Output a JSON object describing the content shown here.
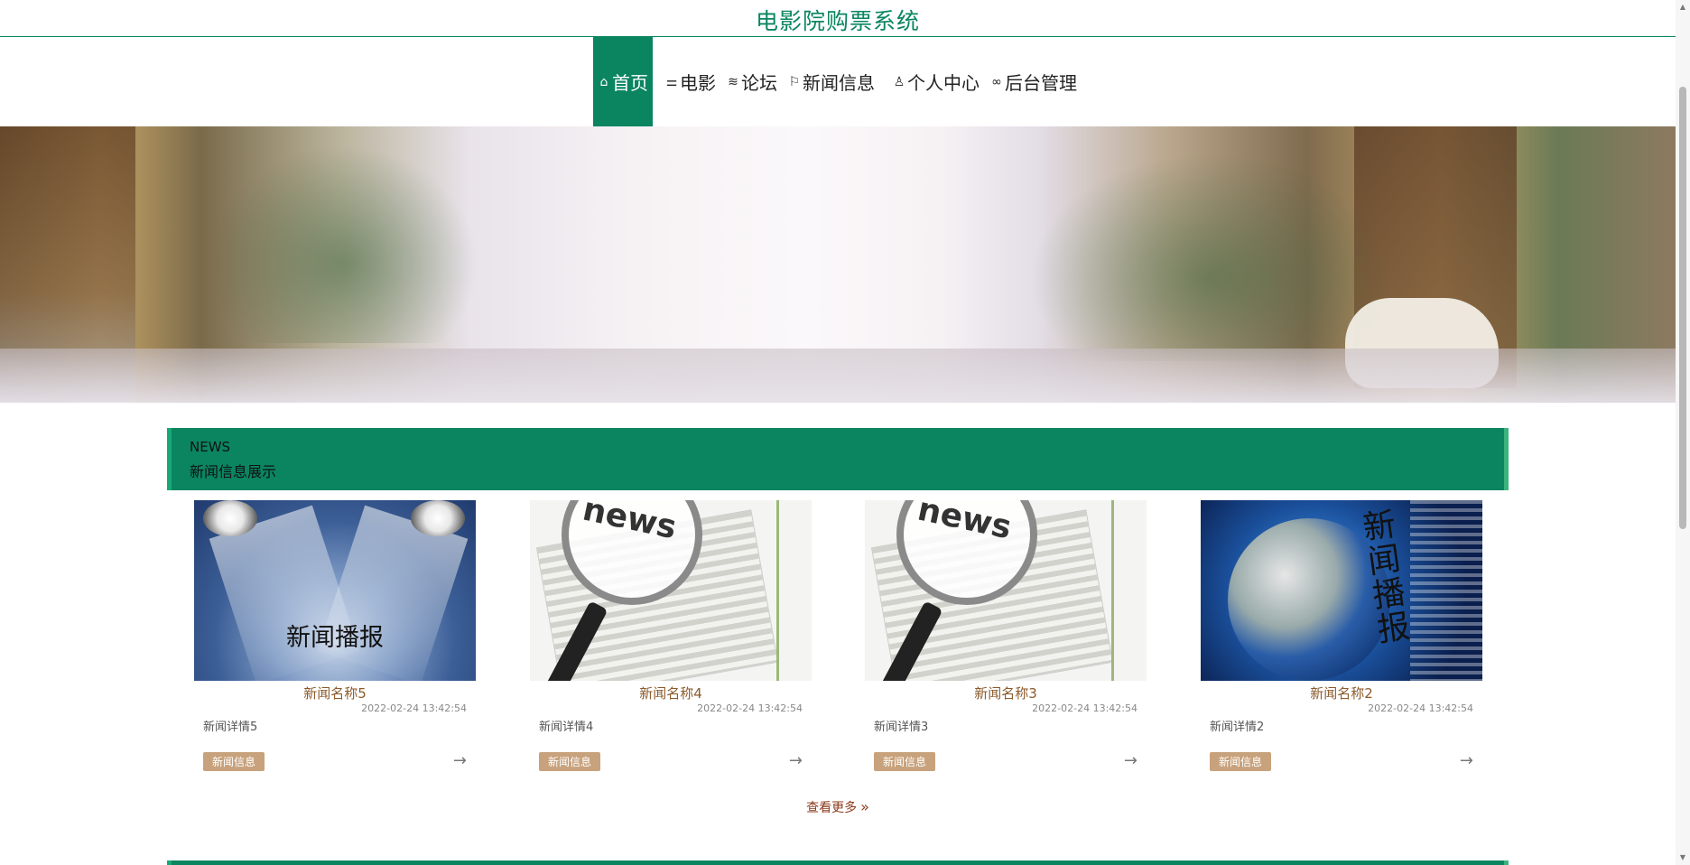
{
  "site": {
    "title": "电影院购票系统"
  },
  "nav": {
    "items": [
      {
        "label": "首页",
        "icon": "home-icon",
        "active": true
      },
      {
        "label": "电影",
        "icon": "sliders-icon",
        "active": false
      },
      {
        "label": "论坛",
        "icon": "layers-icon",
        "active": false
      },
      {
        "label": "新闻信息",
        "icon": "flag-icon",
        "active": false
      },
      {
        "label": "个人中心",
        "icon": "user-icon",
        "active": false
      },
      {
        "label": "后台管理",
        "icon": "link-icon",
        "active": false
      }
    ]
  },
  "banner": {
    "slides": 3,
    "active_slide": 1
  },
  "news": {
    "heading_en": "NEWS",
    "heading_cn": "新闻信息展示",
    "items": [
      {
        "title": "新闻名称5",
        "time": "2022-02-24 13:42:54",
        "desc": "新闻详情5",
        "tag": "新闻信息",
        "image_caption": "新闻播报"
      },
      {
        "title": "新闻名称4",
        "time": "2022-02-24 13:42:54",
        "desc": "新闻详情4",
        "tag": "新闻信息",
        "image_caption": "news"
      },
      {
        "title": "新闻名称3",
        "time": "2022-02-24 13:42:54",
        "desc": "新闻详情3",
        "tag": "新闻信息",
        "image_caption": "news"
      },
      {
        "title": "新闻名称2",
        "time": "2022-02-24 13:42:54",
        "desc": "新闻详情2",
        "tag": "新闻信息",
        "image_caption": "新闻播报"
      }
    ],
    "more_label": "查看更多",
    "arrow": "→"
  },
  "colors": {
    "primary": "#0a8560",
    "title_brown": "#8b5a2b",
    "tag_bg": "#c8a27c",
    "more": "#8b3a1a"
  }
}
